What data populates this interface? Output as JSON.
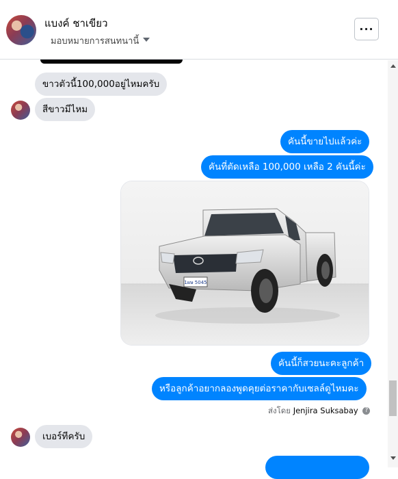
{
  "header": {
    "contact_name": "แบงค์ ชาเขียว",
    "assign_label": "มอบหมายการสนทนานี้",
    "more_label": "···"
  },
  "messages": [
    {
      "from": "contact",
      "text": "ขาวตัวนี้100,000อยู่ไหมครับ"
    },
    {
      "from": "contact",
      "text": "สีขาวมีไหม"
    },
    {
      "from": "page",
      "text": "คันนี้ขายไปแล้วค่ะ"
    },
    {
      "from": "page",
      "text": "คันที่ตัดเหลือ 100,000 เหลือ 2 คันนี้ค่ะ"
    },
    {
      "from": "page",
      "type": "image",
      "alt": "รถกระบะสีเงิน",
      "plate": "1ผษ 5045"
    },
    {
      "from": "page",
      "text": "คันนี้ก็สวยนะคะลูกค้า"
    },
    {
      "from": "page",
      "text": "หรือลูกค้าอยากลองพูดคุยต่อราคากับเซลล์ดูไหมคะ"
    },
    {
      "from": "contact",
      "text": "เบอร์ทีครับ"
    }
  ],
  "sent_by": {
    "prefix": "ส่งโดย",
    "name": "Jenjira Suksabay",
    "icon": "info-icon"
  },
  "colors": {
    "outgoing_bubble": "#0084ff",
    "incoming_bubble": "#e4e6eb",
    "meta_text": "#65676b"
  }
}
